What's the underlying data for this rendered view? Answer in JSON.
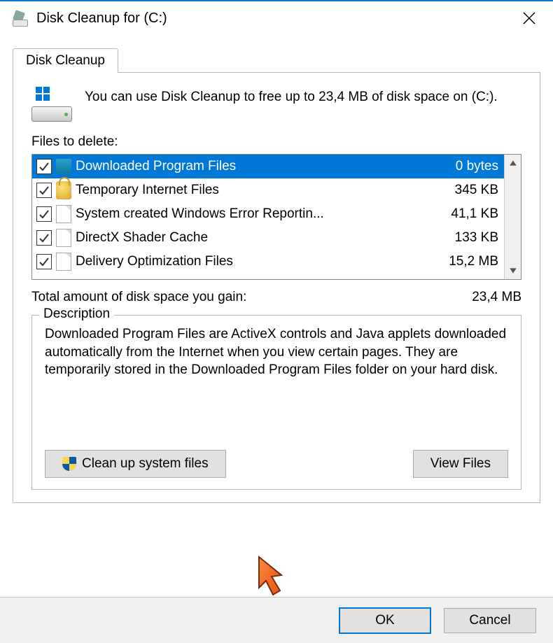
{
  "window": {
    "title": "Disk Cleanup for  (C:)"
  },
  "tab": {
    "label": "Disk Cleanup"
  },
  "intro": "You can use Disk Cleanup to free up to 23,4 MB of disk space on  (C:).",
  "files_label": "Files to delete:",
  "files": [
    {
      "name": "Downloaded Program Files",
      "size": "0 bytes",
      "checked": true,
      "selected": true,
      "icon": "folder"
    },
    {
      "name": "Temporary Internet Files",
      "size": "345 KB",
      "checked": true,
      "selected": false,
      "icon": "lock"
    },
    {
      "name": "System created Windows Error Reportin...",
      "size": "41,1 KB",
      "checked": true,
      "selected": false,
      "icon": "doc"
    },
    {
      "name": "DirectX Shader Cache",
      "size": "133 KB",
      "checked": true,
      "selected": false,
      "icon": "doc"
    },
    {
      "name": "Delivery Optimization Files",
      "size": "15,2 MB",
      "checked": true,
      "selected": false,
      "icon": "doc"
    }
  ],
  "total": {
    "label": "Total amount of disk space you gain:",
    "value": "23,4 MB"
  },
  "description": {
    "legend": "Description",
    "text": "Downloaded Program Files are ActiveX controls and Java applets downloaded automatically from the Internet when you view certain pages. They are temporarily stored in the Downloaded Program Files folder on your hard disk."
  },
  "buttons": {
    "clean_system": "Clean up system files",
    "view_files": "View Files",
    "ok": "OK",
    "cancel": "Cancel"
  }
}
